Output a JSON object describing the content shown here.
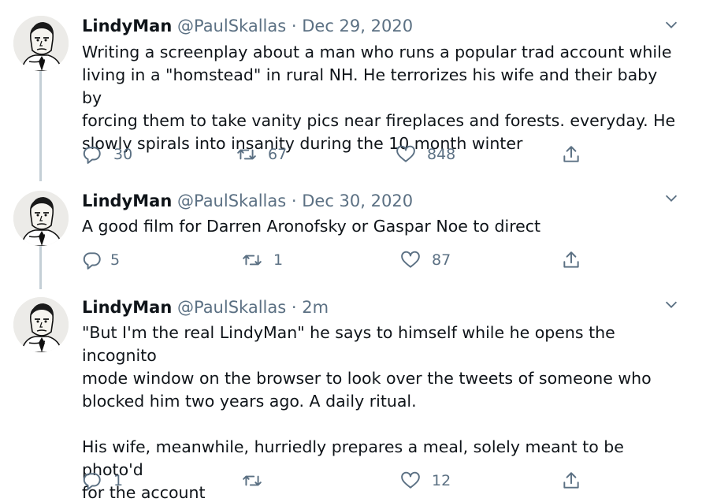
{
  "tweets": [
    {
      "name": "LindyMan",
      "handle": "@PaulSkallas",
      "separator": "·",
      "date": "Dec 29, 2020",
      "text": "Writing a screenplay about a man who runs a popular trad account while\nliving in a \"homstead\" in rural NH. He terrorizes his wife and their baby by\nforcing them to take vanity pics near fireplaces and forests. everyday. He\nslowly spirals into insanity during the 10 month winter",
      "replies": "30",
      "retweets": "67",
      "likes": "848"
    },
    {
      "name": "LindyMan",
      "handle": "@PaulSkallas",
      "separator": "·",
      "date": "Dec 30, 2020",
      "text": "A good film for Darren Aronofsky or Gaspar Noe to direct",
      "replies": "5",
      "retweets": "1",
      "likes": "87"
    },
    {
      "name": "LindyMan",
      "handle": "@PaulSkallas",
      "separator": "·",
      "date": "2m",
      "text": "\"But I'm the real LindyMan\" he says to himself while he opens the incognito\nmode window on the browser to look over the tweets of someone who\nblocked him two years ago. A daily ritual.\n\nHis wife, meanwhile, hurriedly prepares a meal, solely meant to be photo'd\nfor the account",
      "replies": "1",
      "retweets": "",
      "likes": "12"
    }
  ],
  "icons": {
    "reply": "reply-icon",
    "retweet": "retweet-icon",
    "like": "like-icon",
    "share": "share-icon",
    "more": "chevron-down-icon"
  },
  "colors": {
    "text": "#0f1419",
    "secondary": "#5b7083",
    "thread_line": "#c4cfd6"
  }
}
